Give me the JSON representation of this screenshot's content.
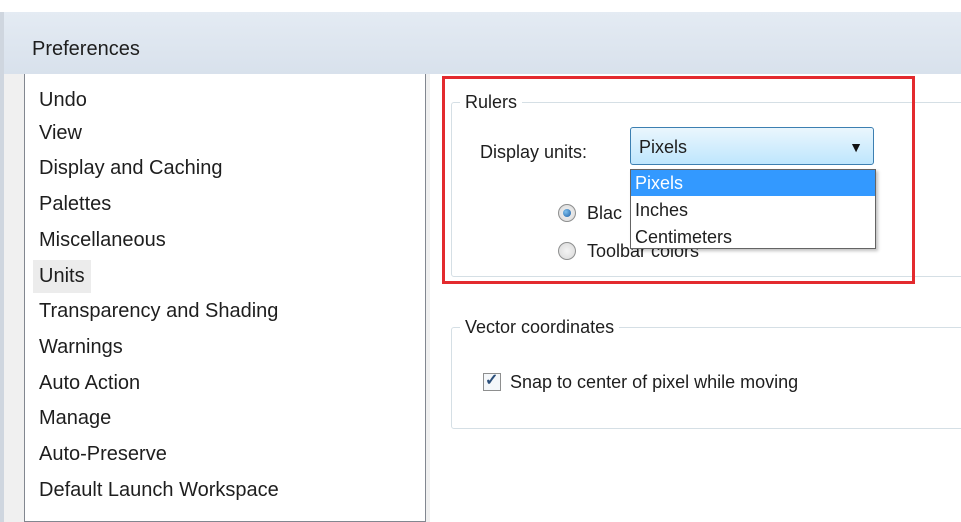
{
  "window": {
    "title": "Preferences"
  },
  "sidebar": {
    "items": [
      {
        "label": "Undo"
      },
      {
        "label": "View"
      },
      {
        "label": "Display and Caching"
      },
      {
        "label": "Palettes"
      },
      {
        "label": "Miscellaneous"
      },
      {
        "label": "Units",
        "selected": true
      },
      {
        "label": "Transparency and Shading"
      },
      {
        "label": "Warnings"
      },
      {
        "label": "Auto Action"
      },
      {
        "label": "Manage"
      },
      {
        "label": "Auto-Preserve"
      },
      {
        "label": "Default Launch Workspace"
      }
    ]
  },
  "rulers": {
    "legend": "Rulers",
    "display_units_label": "Display units:",
    "selected_unit": "Pixels",
    "options": [
      "Pixels",
      "Inches",
      "Centimeters"
    ],
    "radio_1_label": "Blac",
    "radio_2_label": "Toolbar colors"
  },
  "vector": {
    "legend": "Vector coordinates",
    "snap_label": "Snap to center of pixel while moving",
    "snap_checked": true
  },
  "colors": {
    "highlight_frame": "#e32a2e",
    "dropdown_selection": "#3399ff",
    "title_bar": "#dde5ee"
  }
}
